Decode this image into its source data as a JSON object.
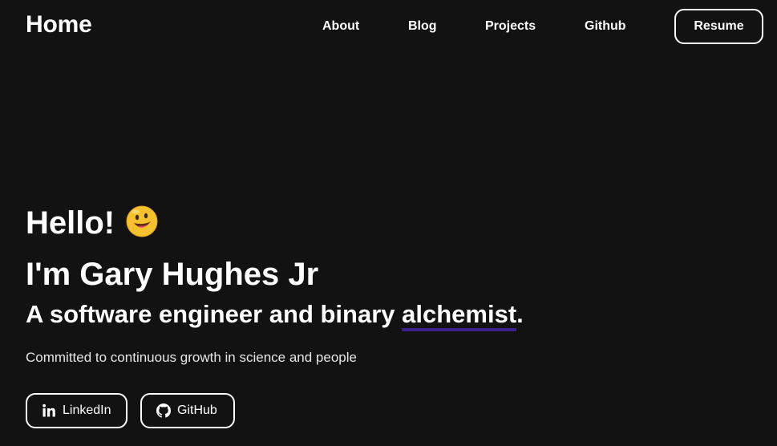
{
  "header": {
    "home_label": "Home",
    "nav": {
      "about": "About",
      "blog": "Blog",
      "projects": "Projects",
      "github": "Github"
    },
    "resume_label": "Resume"
  },
  "hero": {
    "greeting": "Hello!",
    "greeting_icon": "grinning-face-emoji",
    "name": "I'm Gary Hughes Jr",
    "tagline_prefix": "A software engineer and binary ",
    "tagline_highlight": "alchemist",
    "tagline_suffix": ".",
    "subtitle": "Committed to continuous growth in science and people",
    "buttons": {
      "linkedin": {
        "label": "LinkedIn",
        "icon": "linkedin-icon"
      },
      "github": {
        "label": "GitHub",
        "icon": "github-icon"
      }
    }
  },
  "colors": {
    "background": "#121212",
    "text": "#ffffff",
    "highlight_underline": "#3b1f8f"
  }
}
